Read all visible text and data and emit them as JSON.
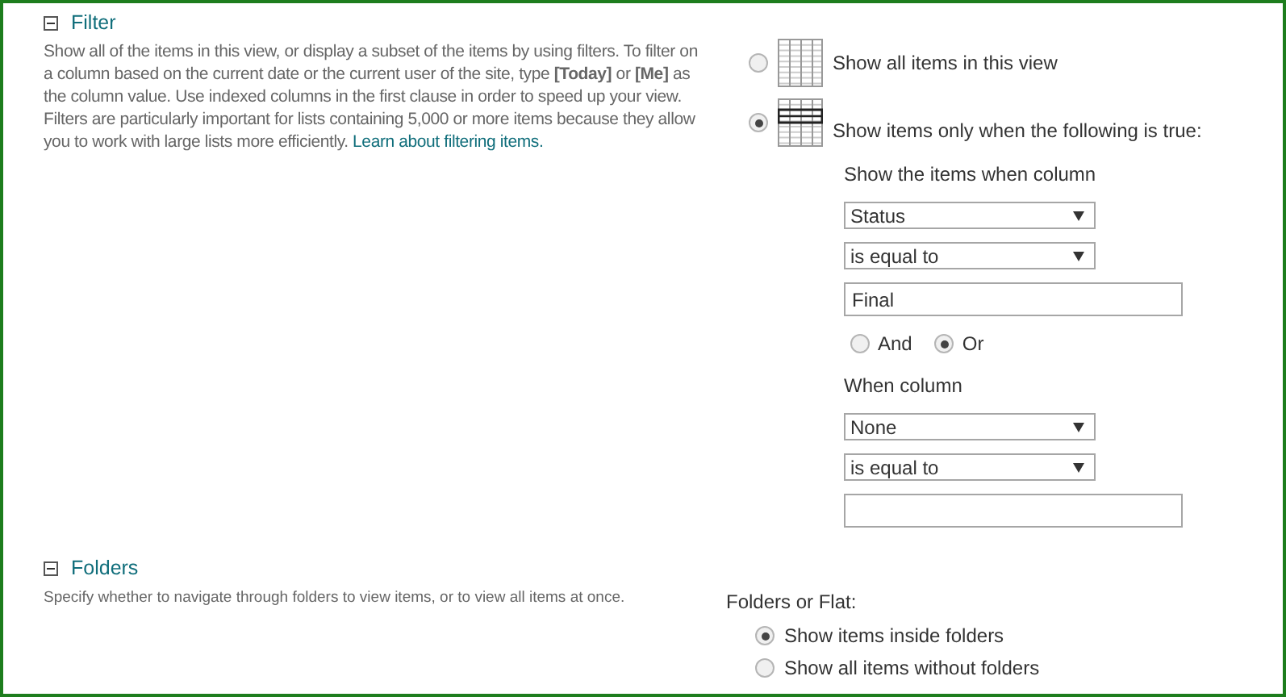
{
  "filter": {
    "title": "Filter",
    "description": "Show all of the items in this view, or display a subset of the items by using filters. To filter on a column based on the current date or the current user of the site, type **[Today]** or **[Me]** as the column value. Use indexed columns in the first clause in order to speed up your view. Filters are particularly important for lists containing 5,000 or more items because they allow you to work with large lists more efficiently.",
    "link": "Learn about filtering items.",
    "options": [
      {
        "label": "Show all items in this view",
        "selected": false,
        "kind": "all"
      },
      {
        "label": "Show items only when the following is true:",
        "selected": true,
        "kind": "filtered"
      }
    ],
    "first_clause": {
      "label": "Show the items when column",
      "column": "Status",
      "operator": "is equal to",
      "value": "Final"
    },
    "conjunctions": [
      {
        "label": "And",
        "selected": false
      },
      {
        "label": "Or",
        "selected": true
      }
    ],
    "second_clause": {
      "label": "When column",
      "column": "None",
      "operator": "is equal to"
    }
  },
  "folders": {
    "title": "Folders",
    "description": "Specify whether to navigate through folders to view items, or to view all items at once.",
    "label": "Folders or Flat:",
    "options": [
      {
        "label": "Show items inside folders",
        "selected": true
      },
      {
        "label": "Show all items without folders",
        "selected": false
      }
    ]
  }
}
